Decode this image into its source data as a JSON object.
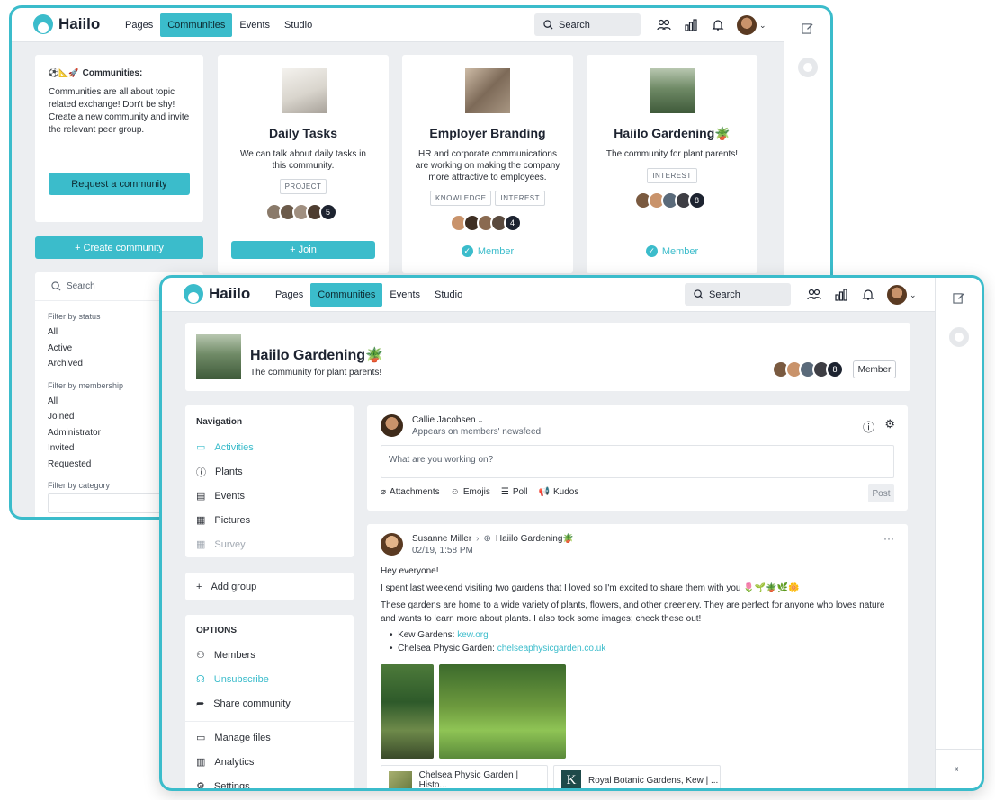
{
  "app": {
    "brand": "Haiilo"
  },
  "nav": {
    "pages": "Pages",
    "communities": "Communities",
    "events": "Events",
    "studio": "Studio"
  },
  "search_label": "Search",
  "colors": {
    "accent": "#3bbccb",
    "dark": "#1d2330",
    "bg": "#eceef1"
  },
  "info_box": {
    "title": "Communities:",
    "text": "Communities are all about topic related exchange! Don't be shy! Create a new community and invite the relevant peer group.",
    "button": "Request a community"
  },
  "create_button": "+ Create community",
  "filters": {
    "search_placeholder": "Search",
    "status_label": "Filter by status",
    "status": [
      "All",
      "Active",
      "Archived"
    ],
    "membership_label": "Filter by membership",
    "membership": [
      "All",
      "Joined",
      "Administrator",
      "Invited",
      "Requested"
    ],
    "category_label": "Filter by category"
  },
  "communities": [
    {
      "title": "Daily Tasks",
      "desc": "We can talk about daily tasks in this community.",
      "tags": [
        "PROJECT"
      ],
      "count": "5",
      "action": "+ Join"
    },
    {
      "title": "Employer Branding",
      "desc": "HR and corporate communications are working on making the company more attractive to employees.",
      "tags": [
        "KNOWLEDGE",
        "INTEREST"
      ],
      "count": "4",
      "action": "Member"
    },
    {
      "title": "Haiilo Gardening🪴",
      "desc": "The community for plant parents!",
      "tags": [
        "INTEREST"
      ],
      "count": "8",
      "action": "Member"
    }
  ],
  "detail": {
    "title": "Haiilo Gardening🪴",
    "subtitle": "The community for plant parents!",
    "member_count": "8",
    "member_button": "Member",
    "navigation_label": "Navigation",
    "nav_items": [
      "Activities",
      "Plants",
      "Events",
      "Pictures",
      "Survey"
    ],
    "add_group": "Add group",
    "options_label": "OPTIONS",
    "options": [
      "Members",
      "Unsubscribe",
      "Share community"
    ],
    "admin": [
      "Manage files",
      "Analytics",
      "Settings"
    ]
  },
  "composer": {
    "author": "Callie Jacobsen",
    "audience": "Appears on members' newsfeed",
    "placeholder": "What are you working on?",
    "tools": [
      "Attachments",
      "Emojis",
      "Poll",
      "Kudos"
    ],
    "post": "Post"
  },
  "post": {
    "author": "Susanne Miller",
    "target": "Haiilo Gardening🪴",
    "time": "02/19, 1:58 PM",
    "greeting": "Hey everyone!",
    "line1": "I spent last weekend visiting two gardens that I loved so I'm excited to share them with you 🌷🌱🪴🌿🌼",
    "line2": "These gardens are home to a wide variety of plants, flowers, and other greenery. They are perfect for anyone who loves nature and wants to learn more about plants. I also took some images; check these out!",
    "bullets": [
      {
        "label": "Kew Gardens:",
        "link": "kew.org"
      },
      {
        "label": "Chelsea Physic Garden:",
        "link": "chelseaphysicgarden.co.uk"
      }
    ],
    "previews": [
      "Chelsea Physic Garden | Histo...",
      "Royal Botanic Gardens, Kew | ..."
    ],
    "preview_k": "K"
  }
}
